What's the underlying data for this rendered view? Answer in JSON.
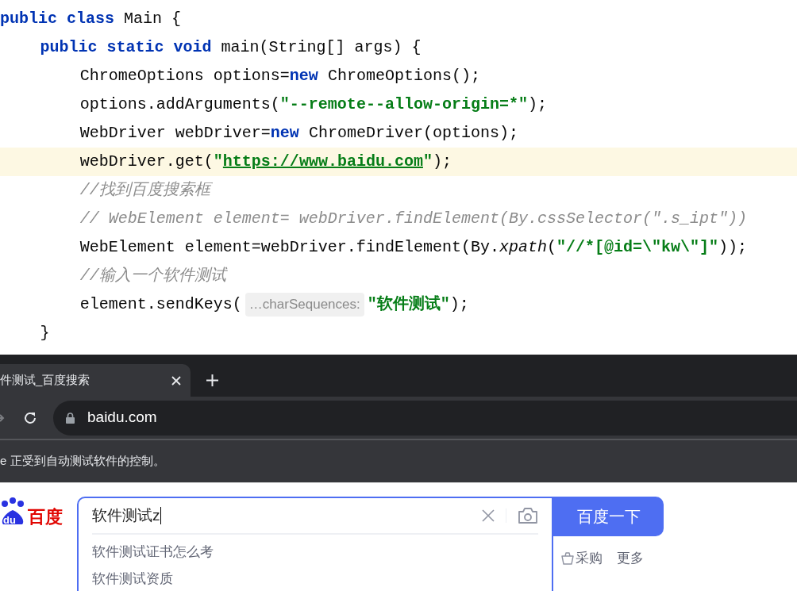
{
  "editor": {
    "code": [
      {
        "current": false,
        "tokens": [
          {
            "kind": "keyword",
            "text": "public class"
          },
          {
            "kind": "plain",
            "text": " Main {"
          }
        ],
        "children": [
          {
            "current": false,
            "tokens": [
              {
                "kind": "keyword",
                "text": "public static void"
              },
              {
                "kind": "plain",
                "text": " main(String[] args) {"
              }
            ],
            "children": [
              {
                "current": false,
                "tokens": [
                  {
                    "kind": "plain",
                    "text": "ChromeOptions options="
                  },
                  {
                    "kind": "keyword",
                    "text": "new"
                  },
                  {
                    "kind": "plain",
                    "text": " ChromeOptions();"
                  }
                ]
              },
              {
                "current": false,
                "tokens": [
                  {
                    "kind": "plain",
                    "text": "options.addArguments("
                  },
                  {
                    "kind": "string",
                    "text": "\"--remote--allow-origin=*\""
                  },
                  {
                    "kind": "plain",
                    "text": ");"
                  }
                ]
              },
              {
                "current": false,
                "tokens": [
                  {
                    "kind": "plain",
                    "text": "WebDriver webDriver="
                  },
                  {
                    "kind": "keyword",
                    "text": "new"
                  },
                  {
                    "kind": "plain",
                    "text": " ChromeDriver(options);"
                  }
                ]
              },
              {
                "current": true,
                "tokens": [
                  {
                    "kind": "plain",
                    "text": "webDriver.get("
                  },
                  {
                    "kind": "string",
                    "text": "\""
                  },
                  {
                    "kind": "link",
                    "text": "https://www.baidu.com"
                  },
                  {
                    "kind": "string",
                    "text": "\""
                  },
                  {
                    "kind": "plain",
                    "text": ");"
                  }
                ]
              },
              {
                "current": false,
                "tokens": [
                  {
                    "kind": "comment",
                    "text": "//找到百度搜索框"
                  }
                ]
              },
              {
                "current": false,
                "tokens": [
                  {
                    "kind": "comment",
                    "text": "// WebElement element= webDriver.findElement(By.cssSelector(\".s_ipt\"))"
                  }
                ]
              },
              {
                "current": false,
                "tokens": [
                  {
                    "kind": "plain",
                    "text": "WebElement element=webDriver.findElement(By."
                  },
                  {
                    "kind": "static",
                    "text": "xpath"
                  },
                  {
                    "kind": "plain",
                    "text": "("
                  },
                  {
                    "kind": "string",
                    "text": "\"//*[@id=\\\"kw\\\"]\""
                  },
                  {
                    "kind": "plain",
                    "text": "));"
                  }
                ]
              },
              {
                "current": false,
                "tokens": [
                  {
                    "kind": "comment",
                    "text": "//输入一个软件测试"
                  }
                ]
              },
              {
                "current": false,
                "tokens": [
                  {
                    "kind": "plain",
                    "text": "element.sendKeys("
                  },
                  {
                    "kind": "hint",
                    "text": "…charSequences:"
                  },
                  {
                    "kind": "string",
                    "text": "\"软件测试\""
                  },
                  {
                    "kind": "plain",
                    "text": ");"
                  }
                ]
              }
            ]
          },
          {
            "current": false,
            "tokens": [
              {
                "kind": "plain",
                "text": "}"
              }
            ]
          }
        ]
      }
    ]
  },
  "browser": {
    "tab": {
      "title": "件测试_百度搜索"
    },
    "address": "baidu.com",
    "infobar": "e 正受到自动测试软件的控制。"
  },
  "page": {
    "logo": {
      "mark": "du",
      "text": "百度"
    },
    "search": {
      "value": "软件测试z",
      "suggestions": [
        "软件测试证书怎么考",
        "软件测试资质"
      ]
    },
    "search_button": "百度一下",
    "links": [
      {
        "kind": "shop",
        "text": "采购"
      },
      {
        "kind": "plain",
        "text": "更多"
      }
    ]
  }
}
